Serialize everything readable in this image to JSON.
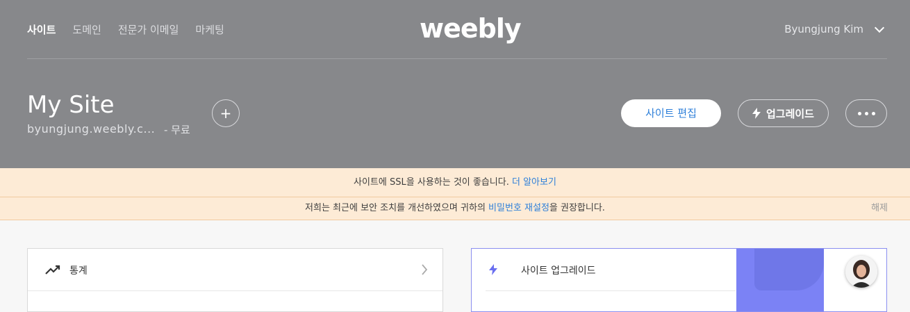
{
  "nav": {
    "items": [
      {
        "label": "사이트",
        "active": true
      },
      {
        "label": "도메인"
      },
      {
        "label": "전문가 이메일"
      },
      {
        "label": "마케팅"
      }
    ],
    "logo": "weebly",
    "user_name": "Byungjung Kim"
  },
  "site": {
    "title": "My Site",
    "url": "byungjung.weebly.c...",
    "plan": "- 무료",
    "add_label": "+",
    "edit_label": "사이트 편집",
    "upgrade_label": "업그레이드"
  },
  "banners": {
    "ssl_text": "사이트에 SSL을 사용하는 것이 좋습니다.",
    "ssl_link": "더 알아보기",
    "security_text_before": "저희는 최근에 보안 조치를 개선하였으며 귀하의 ",
    "security_link": "비밀번호 재설정",
    "security_text_after": "을 권장합니다.",
    "dismiss": "해제"
  },
  "cards": {
    "stats_label": "통계",
    "upgrade_label": "사이트 업그레이드"
  },
  "colors": {
    "header_bg": "#87888b",
    "banner_bg": "#fdebd6",
    "link": "#2d7fd9",
    "upgrade_accent": "#6a6ff0"
  }
}
